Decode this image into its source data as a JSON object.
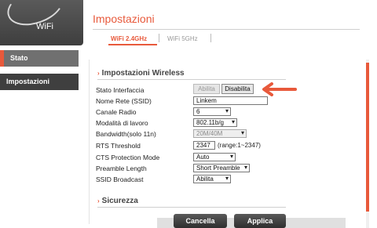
{
  "app": {
    "logo_text": "WiFi"
  },
  "nav": {
    "items": [
      {
        "label": "Stato"
      },
      {
        "label": "Impostazioni"
      }
    ]
  },
  "page": {
    "title": "Impostazioni"
  },
  "tabs": [
    {
      "label": "WiFi 2.4GHz",
      "active": true
    },
    {
      "label": "WiFi 5GHz",
      "active": false
    }
  ],
  "sections": {
    "wireless": "Impostazioni Wireless",
    "security": "Sicurezza"
  },
  "form": {
    "stato_interfaccia": {
      "label": "Stato Interfaccia",
      "buttons": [
        "Abilita",
        "Disabilita"
      ]
    },
    "ssid": {
      "label": "Nome Rete (SSID)",
      "value": "Linkem"
    },
    "channel": {
      "label": "Canale Radio",
      "value": "6"
    },
    "mode": {
      "label": "Modalità di lavoro",
      "value": "802.11b/g"
    },
    "bandwidth": {
      "label": "Bandwidth(solo 11n)",
      "value": "20M/40M"
    },
    "rts": {
      "label": "RTS Threshold",
      "value": "2347",
      "range": "(range:1~2347)"
    },
    "cts": {
      "label": "CTS Protection Mode",
      "value": "Auto"
    },
    "preamble": {
      "label": "Preamble Length",
      "value": "Short Preamble"
    },
    "broadcast": {
      "label": "SSID Broadcast",
      "value": "Abilita"
    }
  },
  "actions": {
    "cancel": "Cancella",
    "apply": "Applica"
  },
  "colors": {
    "accent": "#e8593b",
    "dark": "#3f3f3f"
  }
}
